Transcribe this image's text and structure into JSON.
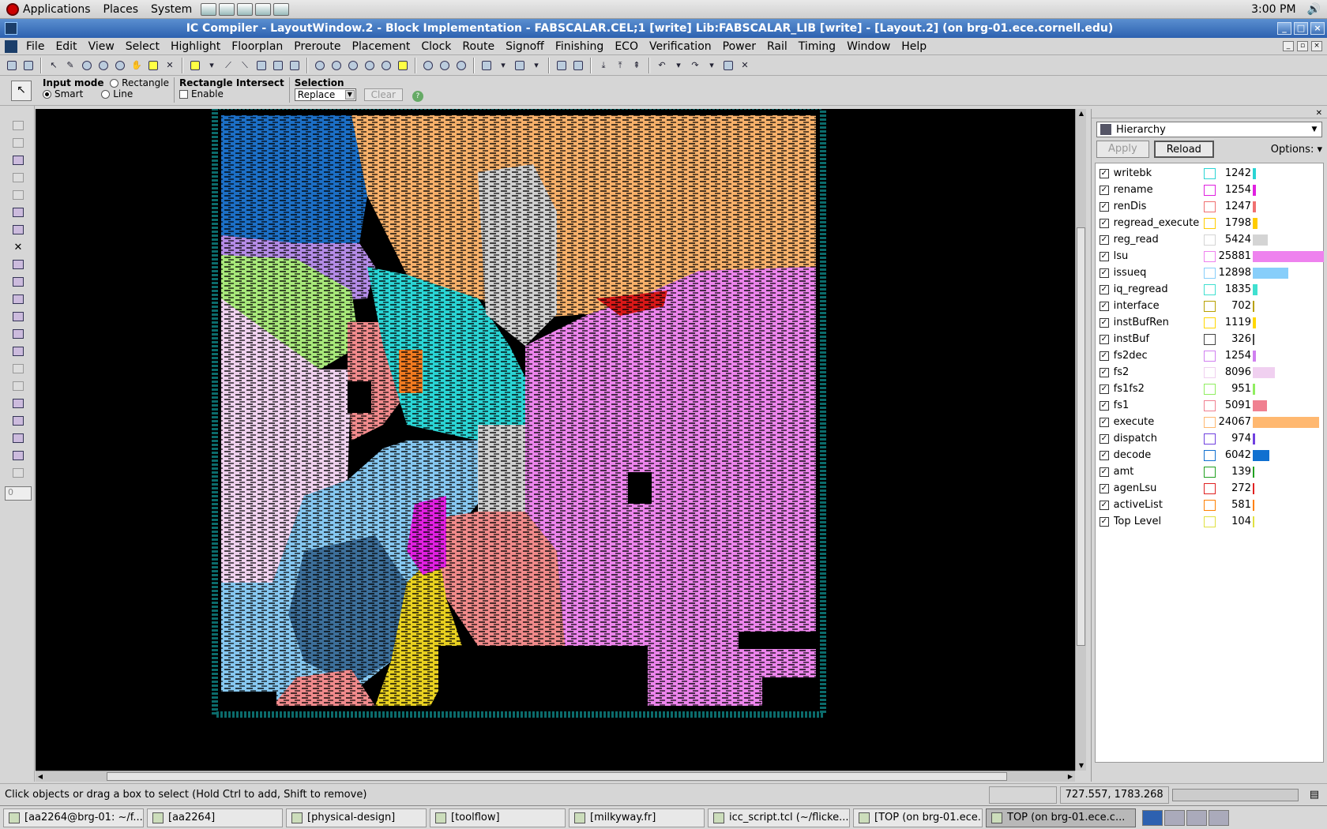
{
  "panel": {
    "menus": [
      "Applications",
      "Places",
      "System"
    ],
    "clock": "3:00 PM"
  },
  "window": {
    "title": "IC Compiler - LayoutWindow.2 - Block Implementation - FABSCALAR.CEL;1 [write]     Lib:FABSCALAR_LIB [write] - [Layout.2] (on brg-01.ece.cornell.edu)"
  },
  "menubar": [
    "File",
    "Edit",
    "View",
    "Select",
    "Highlight",
    "Floorplan",
    "Preroute",
    "Placement",
    "Clock",
    "Route",
    "Signoff",
    "Finishing",
    "ECO",
    "Verification",
    "Power",
    "Rail",
    "Timing",
    "Window",
    "Help"
  ],
  "modebar": {
    "input_mode_label": "Input mode",
    "rectangle": "Rectangle",
    "smart": "Smart",
    "line": "Line",
    "rect_intersect_label": "Rectangle Intersect",
    "enable": "Enable",
    "selection_label": "Selection",
    "selection_value": "Replace",
    "clear": "Clear"
  },
  "left_toolbar": {
    "field_value": "0"
  },
  "hierarchy": {
    "view": "Hierarchy",
    "apply": "Apply",
    "reload": "Reload",
    "options": "Options:",
    "max_count": 25881,
    "modules": [
      {
        "name": "writebk",
        "count": 1242,
        "color": "#2ad4d4"
      },
      {
        "name": "rename",
        "count": 1254,
        "color": "#e020e0"
      },
      {
        "name": "renDis",
        "count": 1247,
        "color": "#f07070"
      },
      {
        "name": "regread_execute",
        "count": 1798,
        "color": "#ffcc00"
      },
      {
        "name": "reg_read",
        "count": 5424,
        "color": "#d4d4d4"
      },
      {
        "name": "lsu",
        "count": 25881,
        "color": "#ee82ee"
      },
      {
        "name": "issueq",
        "count": 12898,
        "color": "#87cefa"
      },
      {
        "name": "iq_regread",
        "count": 1835,
        "color": "#40e0d0"
      },
      {
        "name": "interface",
        "count": 702,
        "color": "#b8a000"
      },
      {
        "name": "instBufRen",
        "count": 1119,
        "color": "#ffd700"
      },
      {
        "name": "instBuf",
        "count": 326,
        "color": "#444444"
      },
      {
        "name": "fs2dec",
        "count": 1254,
        "color": "#d080f0"
      },
      {
        "name": "fs2",
        "count": 8096,
        "color": "#f0d0f0"
      },
      {
        "name": "fs1fs2",
        "count": 951,
        "color": "#90ee60"
      },
      {
        "name": "fs1",
        "count": 5091,
        "color": "#f08090"
      },
      {
        "name": "execute",
        "count": 24067,
        "color": "#ffb870"
      },
      {
        "name": "dispatch",
        "count": 974,
        "color": "#7040e0"
      },
      {
        "name": "decode",
        "count": 6042,
        "color": "#1070d0"
      },
      {
        "name": "amt",
        "count": 139,
        "color": "#20a020"
      },
      {
        "name": "agenLsu",
        "count": 272,
        "color": "#e02020"
      },
      {
        "name": "activeList",
        "count": 581,
        "color": "#ff8000"
      },
      {
        "name": "Top Level",
        "count": 104,
        "color": "#e0e040"
      }
    ]
  },
  "status": {
    "message": "Click objects or drag a box to select (Hold Ctrl to add, Shift to remove)",
    "coords": "727.557, 1783.268"
  },
  "taskbar": [
    {
      "label": "[aa2264@brg-01: ~/f...",
      "active": false
    },
    {
      "label": "[aa2264]",
      "active": false
    },
    {
      "label": "[physical-design]",
      "active": false
    },
    {
      "label": "[toolflow]",
      "active": false
    },
    {
      "label": "[milkyway.fr]",
      "active": false
    },
    {
      "label": "icc_script.tcl (~/flicke...",
      "active": false
    },
    {
      "label": "[TOP (on brg-01.ece....",
      "active": false
    },
    {
      "label": "TOP (on brg-01.ece.c...",
      "active": true
    }
  ]
}
